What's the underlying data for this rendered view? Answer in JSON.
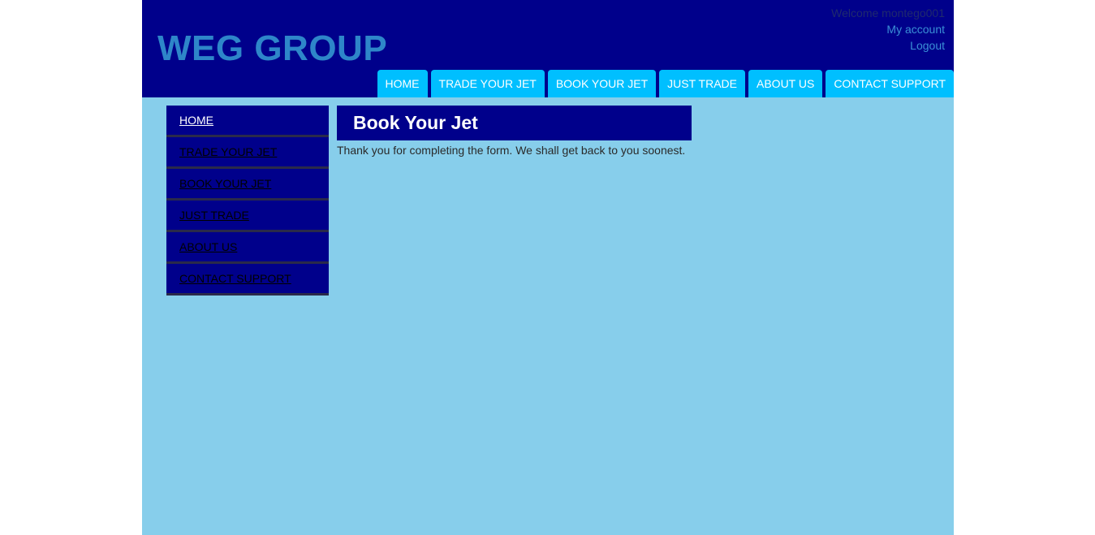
{
  "header": {
    "logo": "WEG GROUP",
    "welcome": "Welcome montego001",
    "my_account": "My account",
    "logout": "Logout"
  },
  "topnav": {
    "items": [
      {
        "label": "HOME"
      },
      {
        "label": "TRADE YOUR JET"
      },
      {
        "label": "BOOK YOUR JET"
      },
      {
        "label": "JUST TRADE"
      },
      {
        "label": "ABOUT US"
      },
      {
        "label": "CONTACT SUPPORT"
      }
    ]
  },
  "sidebar": {
    "items": [
      {
        "label": "HOME"
      },
      {
        "label": "TRADE YOUR JET"
      },
      {
        "label": "BOOK YOUR JET"
      },
      {
        "label": "JUST TRADE"
      },
      {
        "label": "ABOUT US"
      },
      {
        "label": "CONTACT SUPPORT"
      }
    ]
  },
  "content": {
    "title": "Book Your Jet",
    "message": "Thank you for completing the form. We shall get back to you soonest."
  },
  "colors": {
    "header_bg": "#00008b",
    "page_bg": "#87ceeb",
    "tab_bg": "#00bfff",
    "logo": "#2e86c9"
  }
}
